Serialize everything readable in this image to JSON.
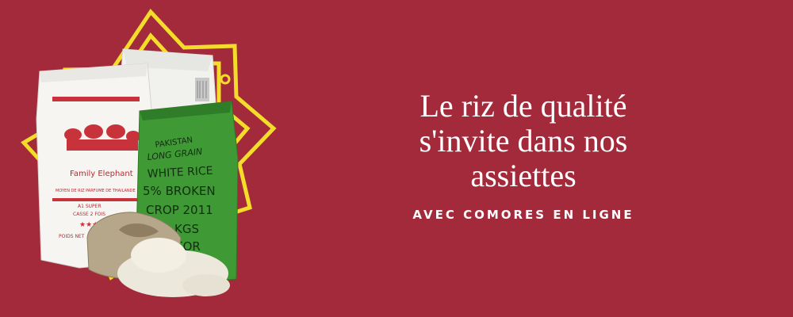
{
  "banner": {
    "background_color": "#a32a3a",
    "accent_color": "#f3dc2a",
    "headline_lines": [
      "Le riz de qualité",
      "s'invite dans nos",
      "assiettes"
    ],
    "tagline": "AVEC COMORES EN LIGNE"
  },
  "sacks": {
    "left": {
      "brand": "Family Elephant",
      "subtitle": "MOYEN DE RIZ PARFUME DE THAILANDE",
      "grade": "A1 SUPER",
      "casse": "CASSE 2 FOIS",
      "poids": "POIDS NET"
    },
    "green": {
      "line1": "PAKISTAN",
      "line2": "LONG GRAIN",
      "line3": "WHITE RICE",
      "line4": "5% BROKEN",
      "line5": "CROP 2011",
      "line6": "KGS",
      "line7": "FOR"
    }
  }
}
